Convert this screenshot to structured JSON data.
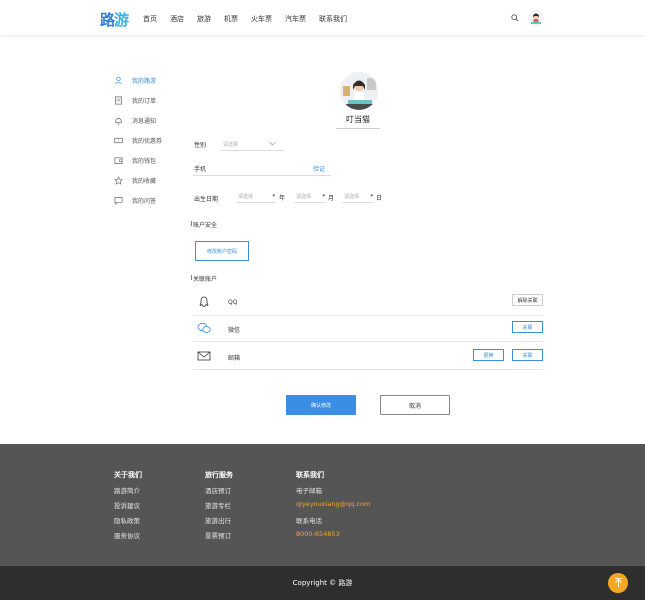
{
  "header": {
    "logo_part1": "路",
    "logo_part2": "游",
    "nav": [
      "首页",
      "酒店",
      "旅游",
      "机票",
      "火车票",
      "汽车票",
      "联系我们"
    ]
  },
  "sidebar": {
    "items": [
      {
        "label": "我的路游",
        "icon": "user-icon",
        "active": true
      },
      {
        "label": "我的订单",
        "icon": "order-icon",
        "active": false
      },
      {
        "label": "消息通知",
        "icon": "bell-icon",
        "active": false
      },
      {
        "label": "我的优惠券",
        "icon": "coupon-icon",
        "active": false
      },
      {
        "label": "我的钱包",
        "icon": "wallet-icon",
        "active": false
      },
      {
        "label": "我的收藏",
        "icon": "star-icon",
        "active": false
      },
      {
        "label": "我的问答",
        "icon": "chat-icon",
        "active": false
      }
    ]
  },
  "profile": {
    "nickname": "叮当猫"
  },
  "form": {
    "gender_label": "性别",
    "gender_placeholder": "请选择",
    "phone_label": "手机",
    "verify_label": "验证",
    "birthday_label": "出生日期",
    "year_placeholder": "请选择",
    "year_unit": "年",
    "month_placeholder": "请选择",
    "month_unit": "月",
    "day_placeholder": "请选择",
    "day_unit": "日"
  },
  "security": {
    "title": "账户安全",
    "change_password": "修改账户密码"
  },
  "linked": {
    "title": "关联账户",
    "accounts": [
      {
        "name": "QQ",
        "icon": "qq-icon",
        "buttons": [
          "解除关联"
        ]
      },
      {
        "name": "微信",
        "icon": "wechat-icon",
        "buttons": [
          "关联"
        ]
      },
      {
        "name": "邮箱",
        "icon": "mail-icon",
        "buttons": [
          "更换",
          "关联"
        ]
      }
    ]
  },
  "actions": {
    "confirm": "确认修改",
    "cancel": "取消"
  },
  "footer": {
    "columns": [
      {
        "title": "关于我们",
        "items": [
          "路游简介",
          "投诉建议",
          "隐私政策",
          "服务协议"
        ]
      },
      {
        "title": "旅行服务",
        "items": [
          "酒店预订",
          "旅游专栏",
          "旅游出行",
          "景票预订"
        ]
      },
      {
        "title": "联系我们",
        "items": [
          "电子邮箱",
          "qiyeyouxiang@qq.com",
          "联系电话",
          "8000-654853"
        ]
      }
    ],
    "copyright": "Copyright © 路游",
    "accent_color": "#f5a623"
  },
  "colors": {
    "primary": "#3a8ee6",
    "footer_bg": "#555555",
    "copyright_bg": "#2e2e2e"
  }
}
